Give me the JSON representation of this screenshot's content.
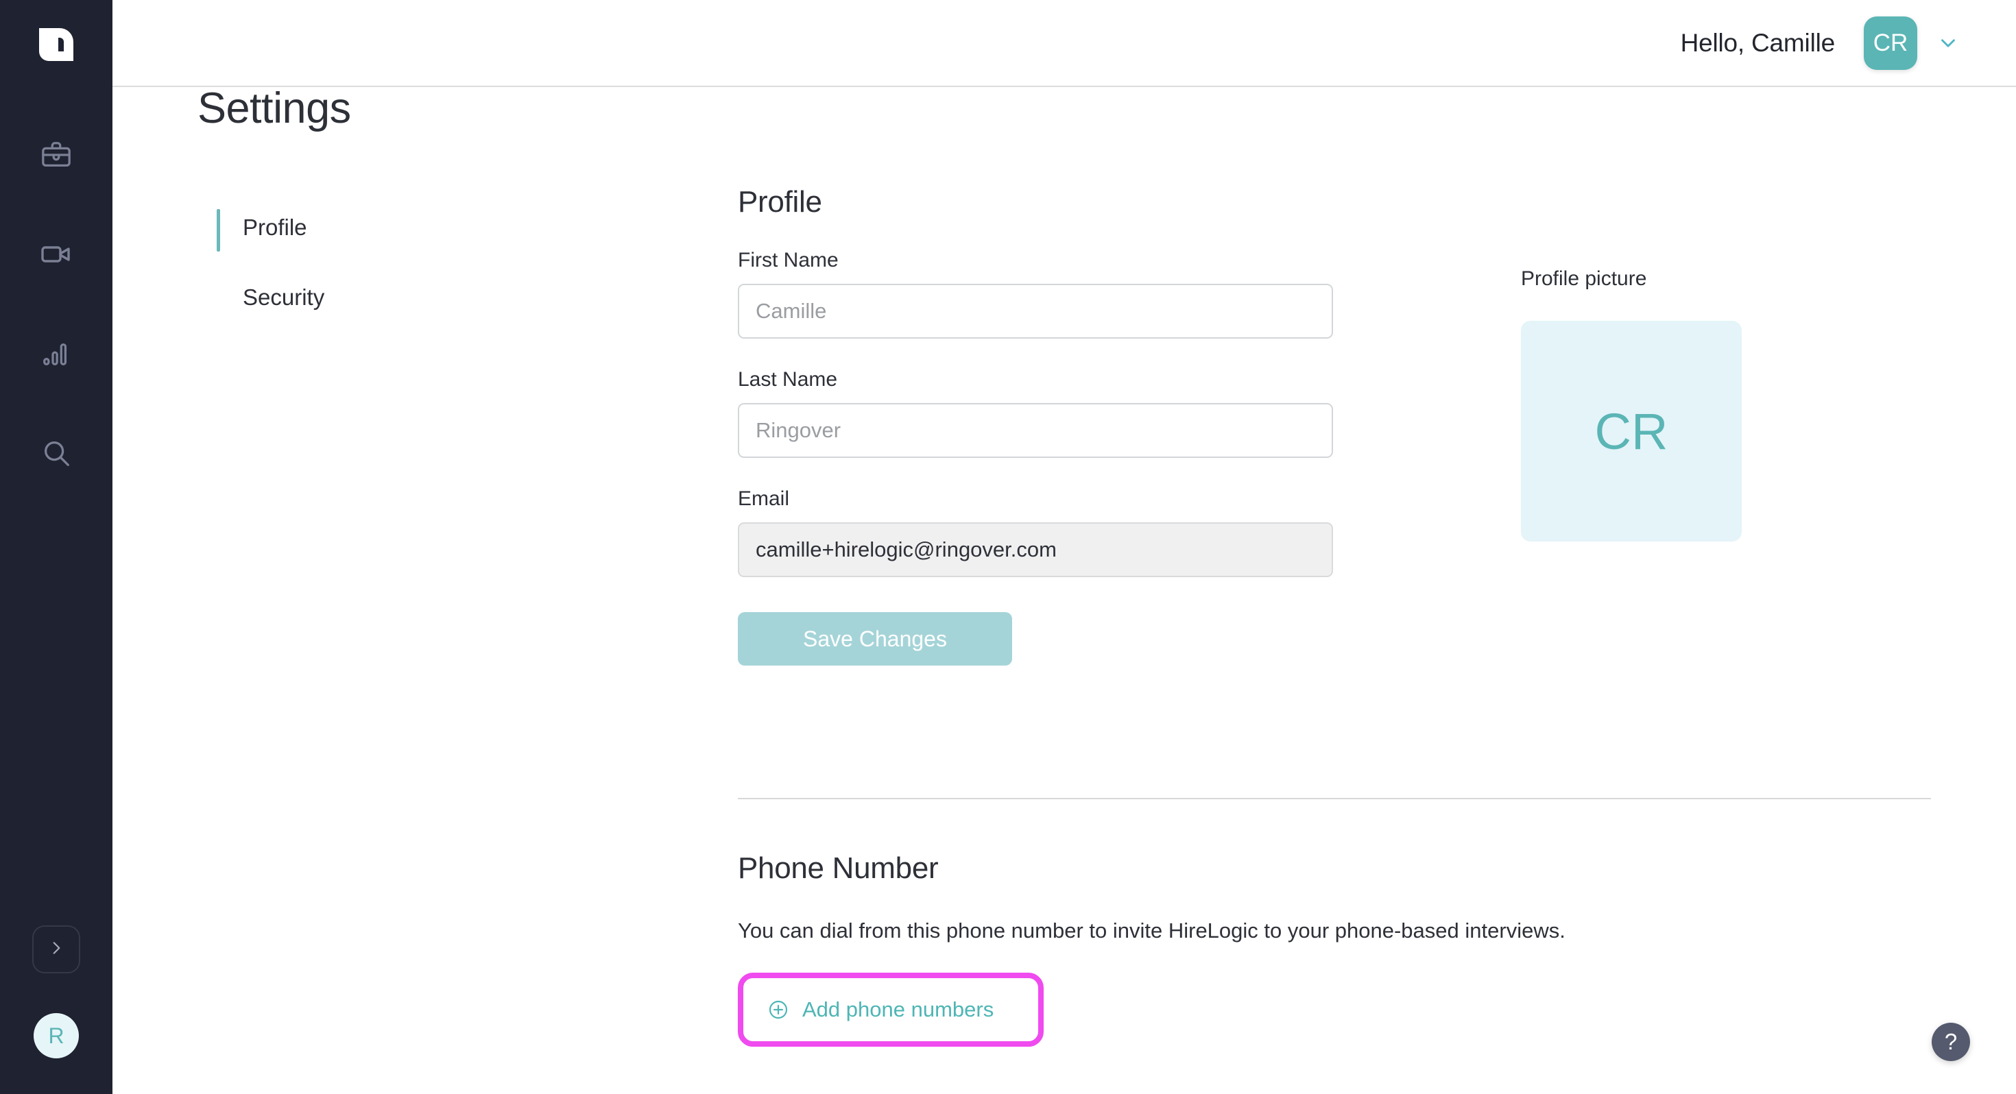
{
  "brand": {
    "logo_name": "hirelogic-logo",
    "accent_teal": "#5bb5b5",
    "accent_teal_muted": "#a5d4d8",
    "sidebar_bg": "#1f2230",
    "highlight_magenta": "#ef4bef",
    "pic_bg": "#e4f4f9"
  },
  "sidebar": {
    "items": [
      {
        "icon": "briefcase-icon",
        "name": "jobs"
      },
      {
        "icon": "video-camera-icon",
        "name": "interviews"
      },
      {
        "icon": "bar-chart-icon",
        "name": "analytics"
      },
      {
        "icon": "search-icon",
        "name": "search"
      }
    ],
    "expand_icon": "chevron-right-icon",
    "user_initial": "R"
  },
  "header": {
    "greeting": "Hello, Camille",
    "avatar_initials": "CR",
    "dropdown_icon": "chevron-down-icon"
  },
  "page": {
    "title": "Settings"
  },
  "settings_nav": {
    "items": [
      {
        "label": "Profile",
        "active": true
      },
      {
        "label": "Security",
        "active": false
      }
    ]
  },
  "profile": {
    "section_title": "Profile",
    "first_name": {
      "label": "First Name",
      "value": "",
      "placeholder": "Camille"
    },
    "last_name": {
      "label": "Last Name",
      "value": "",
      "placeholder": "Ringover"
    },
    "email": {
      "label": "Email",
      "value": "camille+hirelogic@ringover.com",
      "readonly": true
    },
    "save_label": "Save Changes"
  },
  "profile_picture": {
    "label": "Profile picture",
    "initials": "CR"
  },
  "phone": {
    "section_title": "Phone Number",
    "description": "You can dial from this phone number to invite HireLogic to your phone-based interviews.",
    "add_label": "Add phone numbers",
    "add_icon": "circle-plus-icon",
    "highlighted": true
  },
  "help": {
    "label": "?",
    "icon": "question-mark-icon"
  }
}
